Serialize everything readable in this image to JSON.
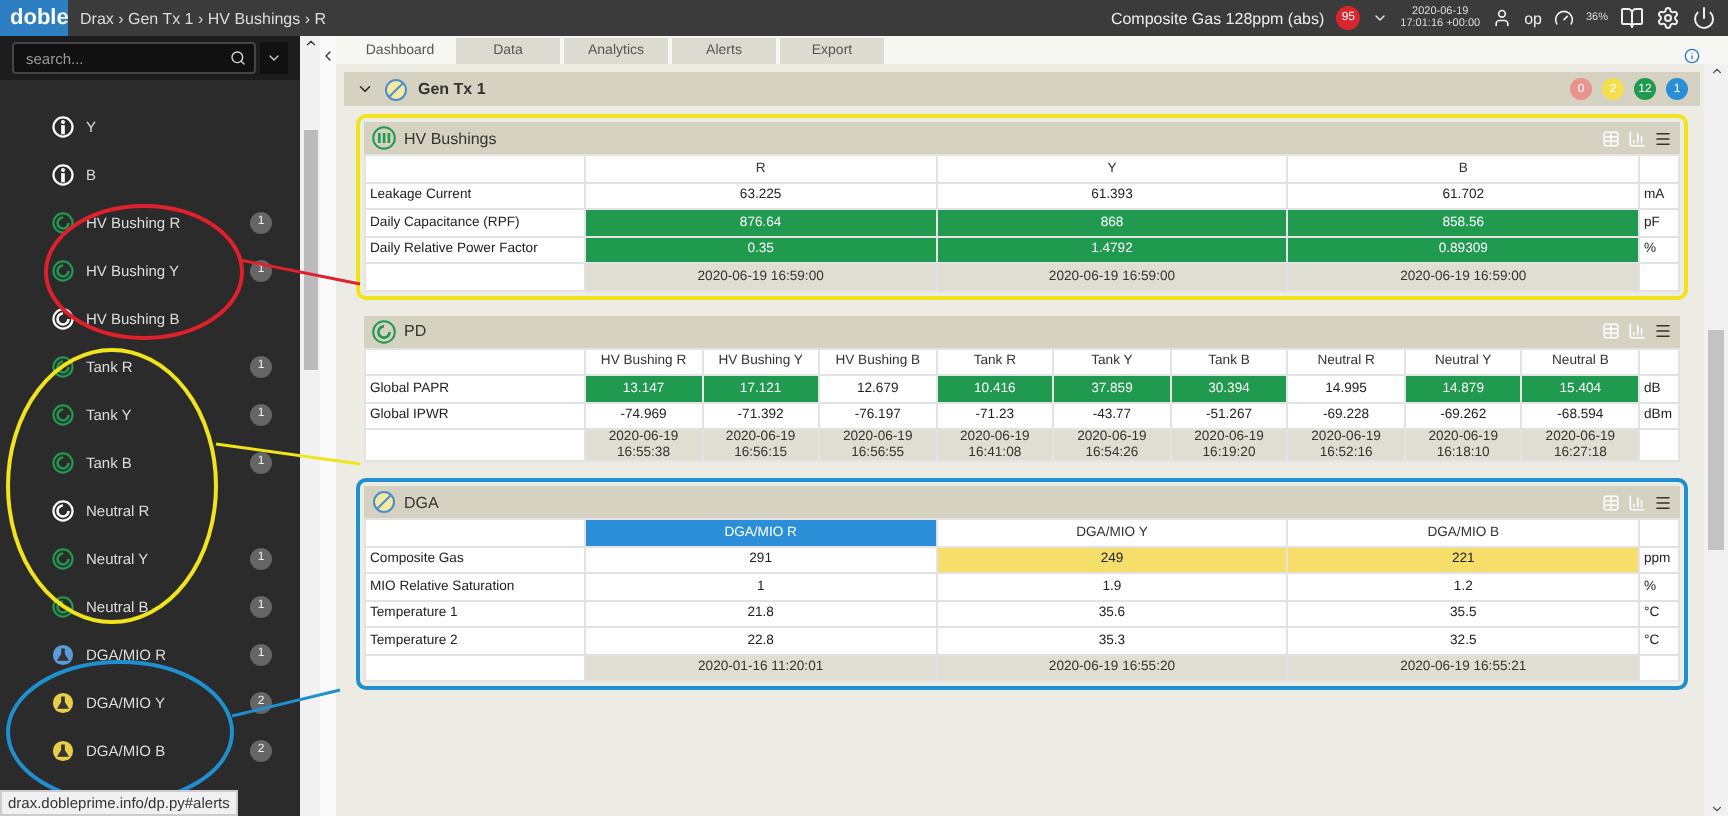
{
  "topbar": {
    "logo": "doble",
    "breadcrumb": "Drax › Gen Tx 1 › HV Bushings › R",
    "alert_text": "Composite Gas 128ppm (abs)",
    "alert_count": "95",
    "date": "2020-06-19",
    "time": "17:01:16 +00:00",
    "user": "op",
    "gauge": "36%"
  },
  "search": {
    "placeholder": "search..."
  },
  "sidebar": {
    "items": [
      {
        "label": "Y",
        "kind": "info"
      },
      {
        "label": "B",
        "kind": "info"
      },
      {
        "label": "HV Bushing R",
        "kind": "sensor",
        "color": "#1f9a4f",
        "count": "1"
      },
      {
        "label": "HV Bushing Y",
        "kind": "sensor",
        "color": "#1f9a4f",
        "count": "1"
      },
      {
        "label": "HV Bushing B",
        "kind": "sensor",
        "color": "#ffffff"
      },
      {
        "label": "Tank R",
        "kind": "sensor",
        "color": "#1f9a4f",
        "count": "1"
      },
      {
        "label": "Tank Y",
        "kind": "sensor",
        "color": "#1f9a4f",
        "count": "1"
      },
      {
        "label": "Tank B",
        "kind": "sensor",
        "color": "#1f9a4f",
        "count": "1"
      },
      {
        "label": "Neutral R",
        "kind": "sensor",
        "color": "#ffffff"
      },
      {
        "label": "Neutral Y",
        "kind": "sensor",
        "color": "#1f9a4f",
        "count": "1"
      },
      {
        "label": "Neutral B",
        "kind": "sensor",
        "color": "#1f9a4f",
        "count": "1"
      },
      {
        "label": "DGA/MIO R",
        "kind": "gas",
        "color": "#5a9bd8",
        "count": "1"
      },
      {
        "label": "DGA/MIO Y",
        "kind": "gas",
        "color": "#e8cf4a",
        "count": "2"
      },
      {
        "label": "DGA/MIO B",
        "kind": "gas",
        "color": "#e8cf4a",
        "count": "2"
      }
    ]
  },
  "status_url": "drax.dobleprime.info/dp.py#alerts",
  "tabs": [
    {
      "label": "Dashboard",
      "selected": true
    },
    {
      "label": "Data",
      "selected": false
    },
    {
      "label": "Analytics",
      "selected": false
    },
    {
      "label": "Alerts",
      "selected": false
    },
    {
      "label": "Export",
      "selected": false
    }
  ],
  "group": {
    "title": "Gen Tx 1",
    "expanded": true,
    "badges": [
      {
        "text": "0",
        "color": "#e8948c"
      },
      {
        "text": "2",
        "color": "#f3e04c"
      },
      {
        "text": "12",
        "color": "#1f9a4f"
      },
      {
        "text": "1",
        "color": "#2a8fd6"
      }
    ]
  },
  "panels": [
    {
      "title": "HV Bushings",
      "kind": "bushing",
      "color": "#f2e41c",
      "columns": [
        {
          "label": "R",
          "selected": false
        },
        {
          "label": "Y",
          "selected": false
        },
        {
          "label": "B",
          "selected": false
        }
      ],
      "rows": [
        {
          "label": "Leakage Current",
          "unit": "mA",
          "cells": [
            {
              "text": "63.225",
              "color": "#ffffff"
            },
            {
              "text": "61.393",
              "color": "#ffffff"
            },
            {
              "text": "61.702",
              "color": "#ffffff"
            }
          ]
        },
        {
          "label": "Daily Capacitance (RPF)",
          "unit": "pF",
          "cells": [
            {
              "text": "876.64",
              "color": "#1f9a4f"
            },
            {
              "text": "868",
              "color": "#1f9a4f"
            },
            {
              "text": "858.56",
              "color": "#1f9a4f"
            }
          ]
        },
        {
          "label": "Daily Relative Power Factor",
          "unit": "%",
          "cells": [
            {
              "text": "0.35",
              "color": "#1f9a4f"
            },
            {
              "text": "1.4792",
              "color": "#1f9a4f"
            },
            {
              "text": "0.89309",
              "color": "#1f9a4f"
            }
          ]
        }
      ],
      "timestamps": [
        "2020-06-19 16:59:00",
        "2020-06-19 16:59:00",
        "2020-06-19 16:59:00"
      ]
    },
    {
      "title": "PD",
      "kind": "sensor",
      "columns": [
        {
          "label": "HV Bushing R",
          "selected": false
        },
        {
          "label": "HV Bushing Y",
          "selected": false
        },
        {
          "label": "HV Bushing B",
          "selected": false
        },
        {
          "label": "Tank R",
          "selected": false
        },
        {
          "label": "Tank Y",
          "selected": false
        },
        {
          "label": "Tank B",
          "selected": false
        },
        {
          "label": "Neutral R",
          "selected": false
        },
        {
          "label": "Neutral Y",
          "selected": false
        },
        {
          "label": "Neutral B",
          "selected": false
        }
      ],
      "rows": [
        {
          "label": "Global PAPR",
          "unit": "dB",
          "cells": [
            {
              "text": "13.147",
              "color": "#1f9a4f"
            },
            {
              "text": "17.121",
              "color": "#1f9a4f"
            },
            {
              "text": "12.679",
              "color": "#ffffff"
            },
            {
              "text": "10.416",
              "color": "#1f9a4f"
            },
            {
              "text": "37.859",
              "color": "#1f9a4f"
            },
            {
              "text": "30.394",
              "color": "#1f9a4f"
            },
            {
              "text": "14.995",
              "color": "#ffffff"
            },
            {
              "text": "14.879",
              "color": "#1f9a4f"
            },
            {
              "text": "15.404",
              "color": "#1f9a4f"
            }
          ]
        },
        {
          "label": "Global IPWR",
          "unit": "dBm",
          "cells": [
            {
              "text": "-74.969",
              "color": "#ffffff"
            },
            {
              "text": "-71.392",
              "color": "#ffffff"
            },
            {
              "text": "-76.197",
              "color": "#ffffff"
            },
            {
              "text": "-71.23",
              "color": "#ffffff"
            },
            {
              "text": "-43.77",
              "color": "#ffffff"
            },
            {
              "text": "-51.267",
              "color": "#ffffff"
            },
            {
              "text": "-69.228",
              "color": "#ffffff"
            },
            {
              "text": "-69.262",
              "color": "#ffffff"
            },
            {
              "text": "-68.594",
              "color": "#ffffff"
            }
          ]
        }
      ],
      "timestamps": [
        "2020-06-19 16:55:38",
        "2020-06-19 16:56:15",
        "2020-06-19 16:56:55",
        "2020-06-19 16:41:08",
        "2020-06-19 16:54:26",
        "2020-06-19 16:19:20",
        "2020-06-19 16:52:16",
        "2020-06-19 16:18:10",
        "2020-06-19 16:27:18"
      ]
    },
    {
      "title": "DGA",
      "kind": "gas",
      "color": "#1e90d0",
      "columns": [
        {
          "label": "DGA/MIO R",
          "selected": true
        },
        {
          "label": "DGA/MIO Y",
          "selected": false
        },
        {
          "label": "DGA/MIO B",
          "selected": false
        }
      ],
      "rows": [
        {
          "label": "Composite Gas",
          "unit": "ppm",
          "cells": [
            {
              "text": "291",
              "color": "#ffffff"
            },
            {
              "text": "249",
              "color": "#f6de6a"
            },
            {
              "text": "221",
              "color": "#f6de6a"
            }
          ]
        },
        {
          "label": "MIO Relative Saturation",
          "unit": "%",
          "cells": [
            {
              "text": "1",
              "color": "#ffffff"
            },
            {
              "text": "1.9",
              "color": "#ffffff"
            },
            {
              "text": "1.2",
              "color": "#ffffff"
            }
          ]
        },
        {
          "label": "Temperature 1",
          "unit": "°C",
          "cells": [
            {
              "text": "21.8",
              "color": "#ffffff"
            },
            {
              "text": "35.6",
              "color": "#ffffff"
            },
            {
              "text": "35.5",
              "color": "#ffffff"
            }
          ]
        },
        {
          "label": "Temperature 2",
          "unit": "°C",
          "cells": [
            {
              "text": "22.8",
              "color": "#ffffff"
            },
            {
              "text": "35.3",
              "color": "#ffffff"
            },
            {
              "text": "32.5",
              "color": "#ffffff"
            }
          ]
        }
      ],
      "timestamps": [
        "2020-01-16 11:20:01",
        "2020-06-19 16:55:20",
        "2020-06-19 16:55:21"
      ]
    }
  ],
  "annotations": [
    {
      "color": "#e0202a"
    },
    {
      "color": "#f2e41c"
    },
    {
      "color": "#1e90d0"
    }
  ]
}
